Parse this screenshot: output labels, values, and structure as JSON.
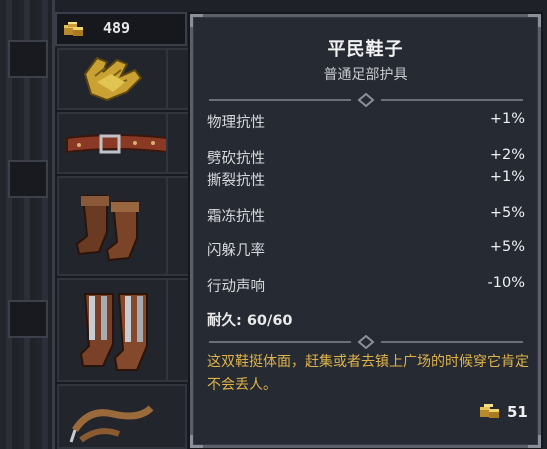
{
  "currency": {
    "amount": "489",
    "icon": "gold-coins-icon"
  },
  "inventory": {
    "items": [
      {
        "name": "gloves-item",
        "icon": "yellow-gloves-icon"
      },
      {
        "name": "belt-item",
        "icon": "leather-belt-icon"
      },
      {
        "name": "boots-item",
        "icon": "brown-boots-icon"
      },
      {
        "name": "armored-boots-item",
        "icon": "metal-greaves-icon"
      },
      {
        "name": "rope-item",
        "icon": "rope-icon"
      }
    ]
  },
  "tooltip": {
    "title": "平民鞋子",
    "subtitle": "普通足部护具",
    "stats": [
      {
        "label": "物理抗性",
        "value": "+1%"
      },
      {
        "label": "劈砍抗性",
        "value": "+2%"
      },
      {
        "label": "撕裂抗性",
        "value": "+1%"
      },
      {
        "label": "霜冻抗性",
        "value": "+5%"
      },
      {
        "label": "闪躲几率",
        "value": "+5%"
      },
      {
        "label": "行动声响",
        "value": "-10%"
      }
    ],
    "durability": "耐久: 60/60",
    "description": "这双鞋挺体面，赶集或者去镇上广场的时候穿它肯定不会丢人。",
    "price": "51"
  },
  "colors": {
    "accent_gold": "#e0b34a",
    "panel_bg": "#262a32",
    "border": "#5a5f6a"
  }
}
